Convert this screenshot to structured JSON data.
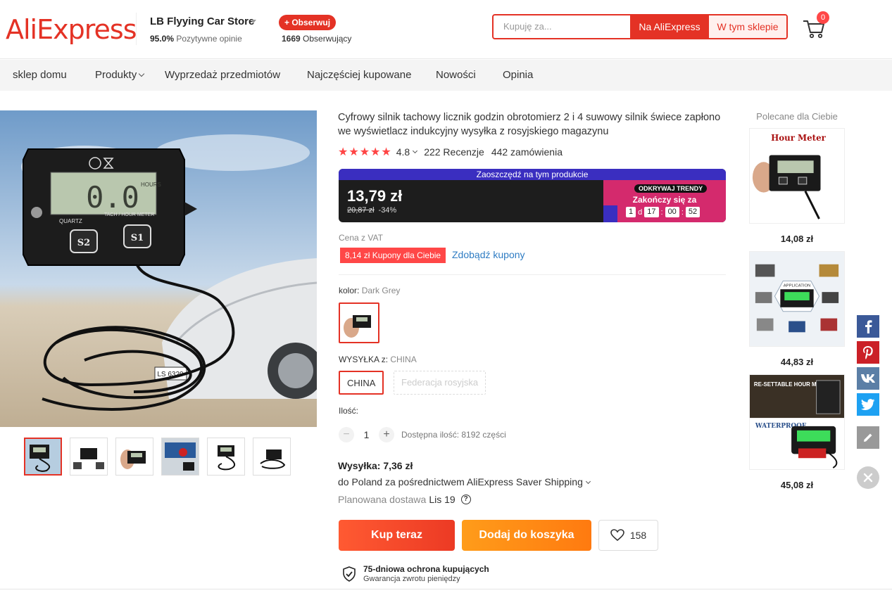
{
  "header": {
    "logo": "AliExpress",
    "store_name": "LB Flyying Car Store",
    "store_rating_pct": "95.0%",
    "store_rating_label": "Pozytywne opinie",
    "follow_label": "+ Obserwuj",
    "followers_count": "1669",
    "followers_label": "Obserwujący",
    "search_placeholder": "Kupuję za...",
    "search_btn_ali": "Na AliExpress",
    "search_btn_store": "W tym sklepie",
    "cart_count": "0"
  },
  "nav": {
    "items": [
      "sklep domu",
      "Produkty",
      "Wyprzedaż przedmiotów",
      "Najczęściej kupowane",
      "Nowości",
      "Opinia"
    ]
  },
  "product": {
    "title": "Cyfrowy silnik tachowy licznik godzin obrotomierz 2 i 4 suwowy silnik świece zapłono we wyświetlacz indukcyjny wysyłka z rosyjskiego magazynu",
    "rating": "4.8",
    "reviews": "222 Recenzje",
    "orders": "442 zamówienia",
    "image_text": {
      "meter_mode": "QUARTZ",
      "meter_label": "TACH / HOUR METER",
      "meter_display": "0.0",
      "meter_unit": "HOURS",
      "btn_s2": "S2",
      "btn_s1": "S1",
      "plate": "LS 6320"
    },
    "price_banner": "Zaoszczędź na tym produkcie",
    "price": "13,79 zł",
    "old_price": "20,87 zł",
    "discount": "-34%",
    "promo_tag": "ODKRYWAJ TRENDY",
    "promo_end": "Zakończy się za",
    "countdown": {
      "days": "1",
      "d_label": "d",
      "hours": "17",
      "minutes": "00",
      "seconds": "52"
    },
    "vat": "Cena z VAT",
    "coupon": "8,14 zł Kupony dla Ciebie",
    "coupon_link": "Zdobądź kupony",
    "color_label": "kolor:",
    "color_value": "Dark Grey",
    "ship_from_label": "WYSYŁKA z:",
    "ship_from_value": "CHINA",
    "ship_options": [
      "CHINA",
      "Federacja rosyjska"
    ],
    "qty_label": "Ilość:",
    "qty_value": "1",
    "qty_avail": "Dostępna ilość: 8192 części",
    "shipping_cost": "Wysyłka: 7,36 zł",
    "shipping_via": "do Poland za pośrednictwem AliExpress Saver Shipping",
    "delivery_label": "Planowana dostawa",
    "delivery_date": "Lis 19",
    "buy_now": "Kup teraz",
    "add_to_cart": "Dodaj do koszyka",
    "wish_count": "158",
    "protection_title": "75-dniowa ochrona kupujących",
    "protection_sub": "Gwarancja zwrotu pieniędzy"
  },
  "recommended": {
    "title": "Polecane dla Ciebie",
    "items": [
      {
        "price": "14,08 zł",
        "image_text": "Hour Meter"
      },
      {
        "price": "44,83 zł",
        "image_text": "APPLICATION"
      },
      {
        "price": "45,08 zł",
        "image_text": "RE-SETTABLE HOUR METER",
        "image_text2": "WATERPROOF"
      }
    ]
  },
  "social": [
    "facebook-icon",
    "pinterest-icon",
    "vk-icon",
    "twitter-icon",
    "edit-icon"
  ],
  "colors": {
    "brand": "#e43225",
    "buy": "#f2472b",
    "cart": "#ff8f14",
    "link": "#2e7cc3"
  }
}
